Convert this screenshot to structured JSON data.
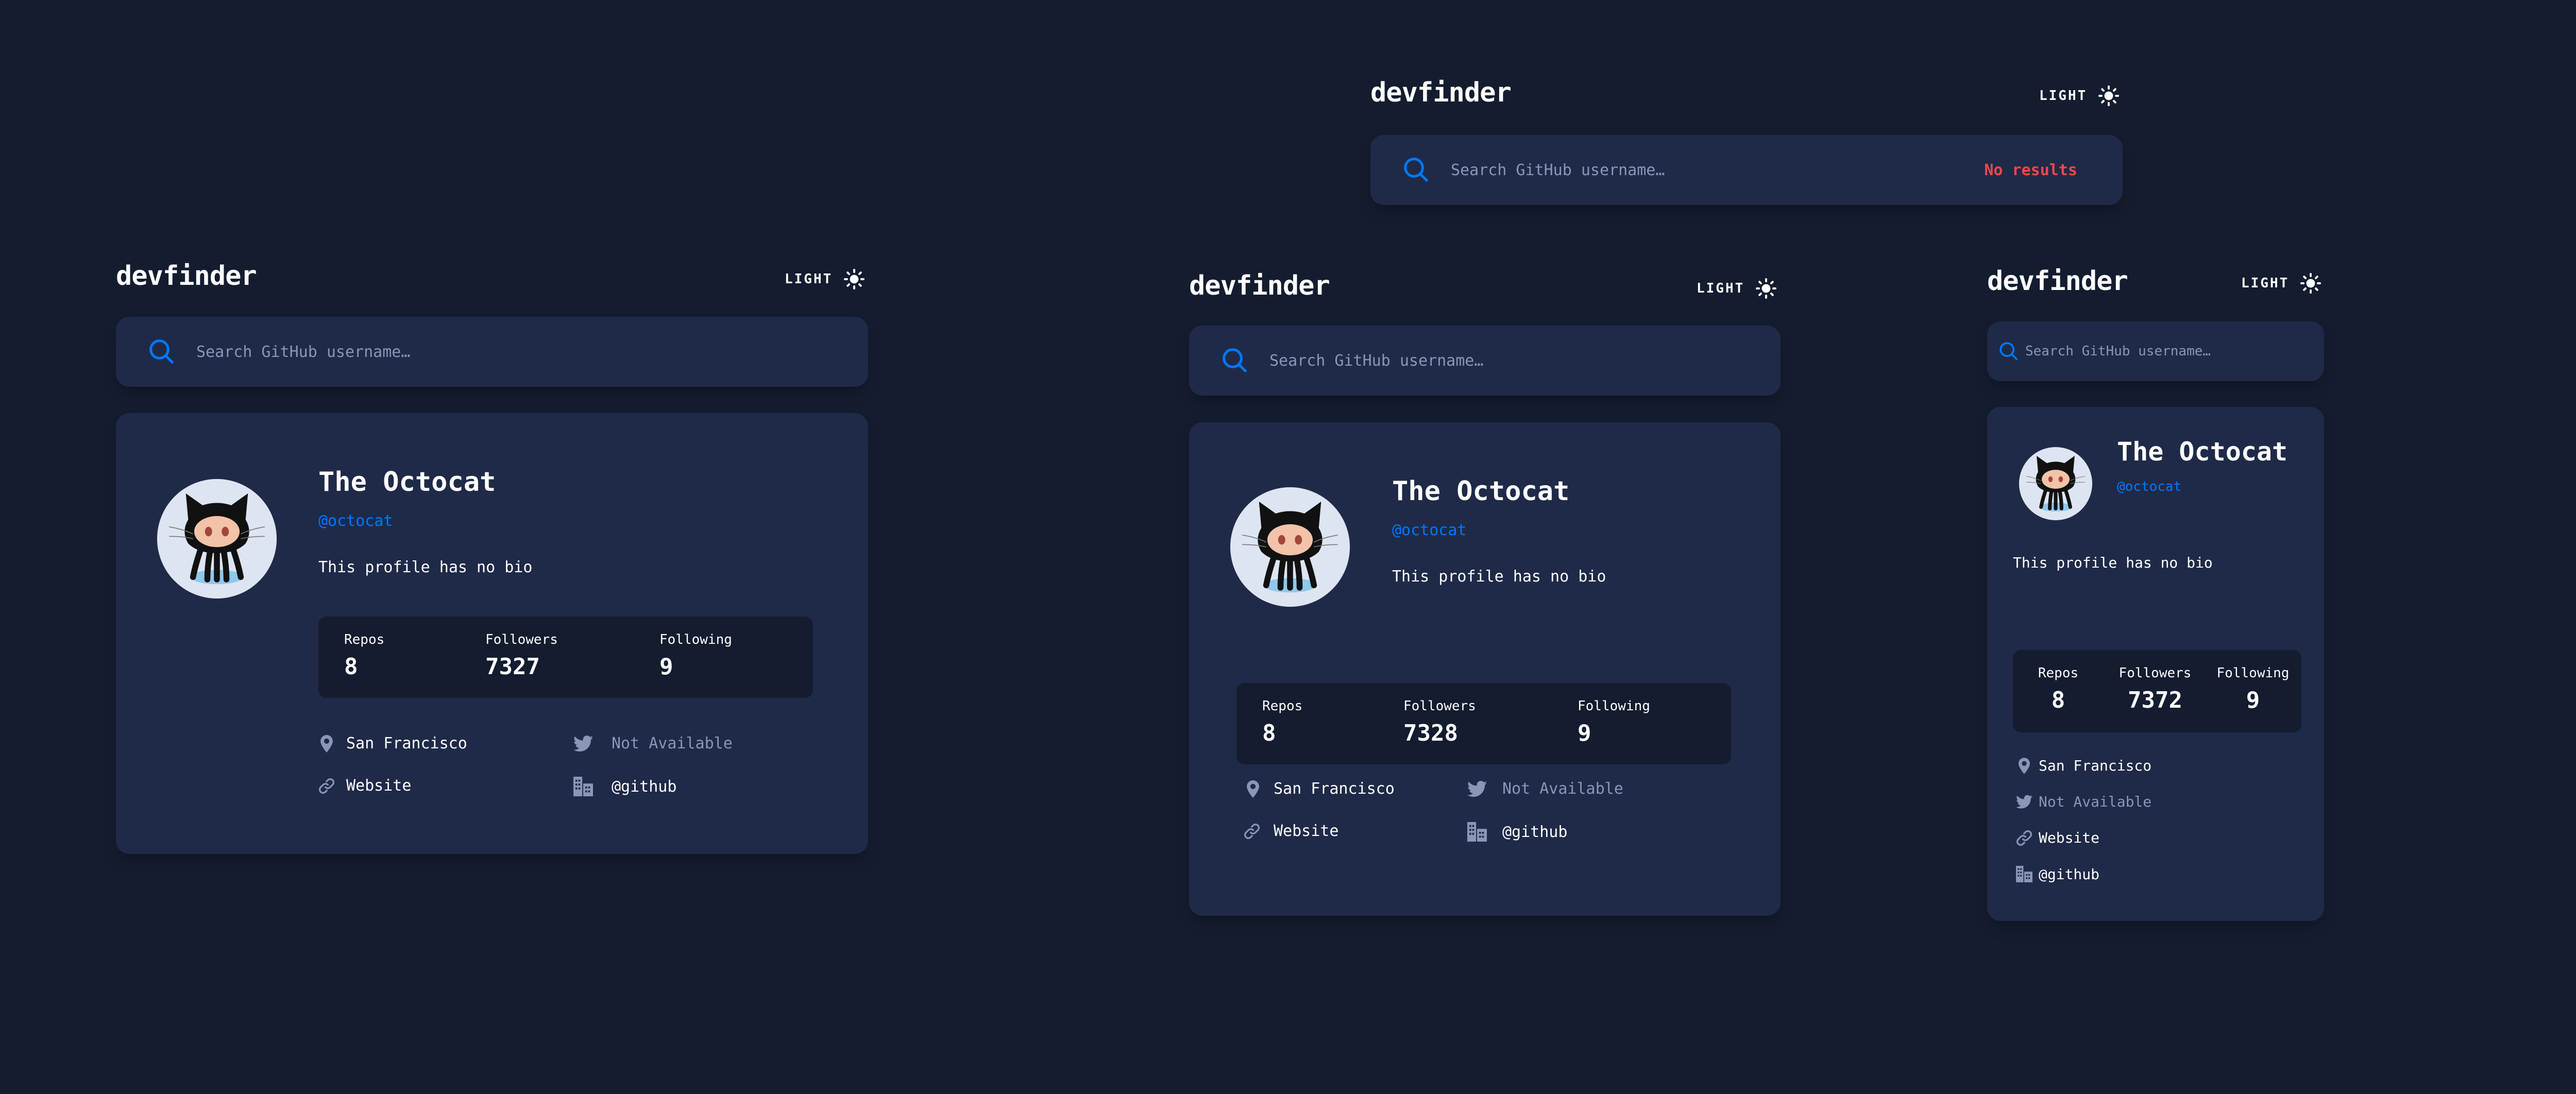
{
  "app": {
    "logo": "devfinder",
    "theme_label": "LIGHT",
    "search_placeholder": "Search GitHub username…",
    "no_results": "No results"
  },
  "colors": {
    "background": "#141c2f",
    "card": "#1f2a48",
    "accent": "#0079ff",
    "error": "#f74646",
    "muted": "#8a96b5"
  },
  "profile": {
    "name": "The Octocat",
    "handle": "@octocat",
    "bio": "This profile has no bio",
    "location": "San Francisco",
    "twitter": "Not Available",
    "website": "Website",
    "company": "@github"
  },
  "stats_labels": {
    "repos": "Repos",
    "followers": "Followers",
    "following": "Following"
  },
  "views": {
    "desktop": {
      "repos": "8",
      "followers": "7327",
      "following": "9"
    },
    "tablet": {
      "repos": "8",
      "followers": "7328",
      "following": "9"
    },
    "mobile": {
      "repos": "8",
      "followers": "7372",
      "following": "9"
    }
  },
  "icons": [
    "search-icon",
    "sun-icon",
    "location-icon",
    "twitter-icon",
    "link-icon",
    "company-icon"
  ]
}
